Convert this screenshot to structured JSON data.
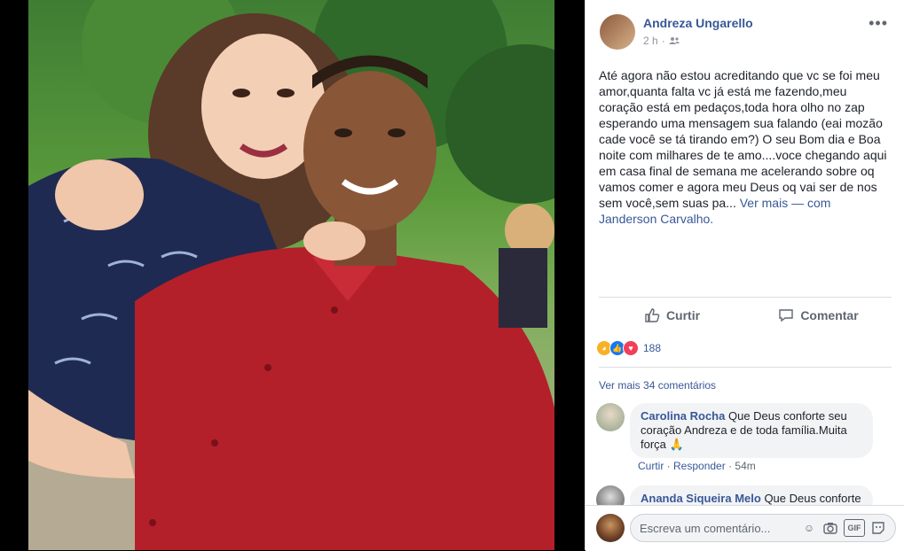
{
  "post": {
    "author": "Andreza Ungarello",
    "time": "2 h",
    "more_label": "•••",
    "text": "Até agora não estou acreditando que vc se foi meu amor,quanta falta vc já está me fazendo,meu coração está em pedaços,toda hora olho no zap esperando uma mensagem sua falando (eai mozão cade você se tá tirando em?) O seu Bom dia e Boa noite com milhares de te amo....voce chegando aqui em casa final de semana me acelerando sobre oq vamos comer e agora meu Deus oq vai ser de nos sem você,sem suas pa...",
    "see_more": "Ver mais",
    "with_text": "— com",
    "tagged": "Janderson Carvalho."
  },
  "actions": {
    "like": "Curtir",
    "comment": "Comentar"
  },
  "reactions": {
    "count": "188",
    "icons": [
      "sad-icon",
      "like-icon",
      "love-icon"
    ]
  },
  "comments": {
    "view_more": "Ver mais 34 comentários",
    "items": [
      {
        "name": "Carolina Rocha",
        "text": "Que Deus conforte seu coração Andreza e de toda família.Muita força 🙏",
        "like": "Curtir",
        "reply": "Responder",
        "time": "54m"
      },
      {
        "name": "Ananda Siqueira Melo",
        "text": "Que Deus conforte"
      }
    ]
  },
  "composer": {
    "placeholder": "Escreva um comentário...",
    "gif": "GIF"
  },
  "colors": {
    "link": "#385898",
    "text": "#1d2129",
    "muted": "#90949c"
  }
}
